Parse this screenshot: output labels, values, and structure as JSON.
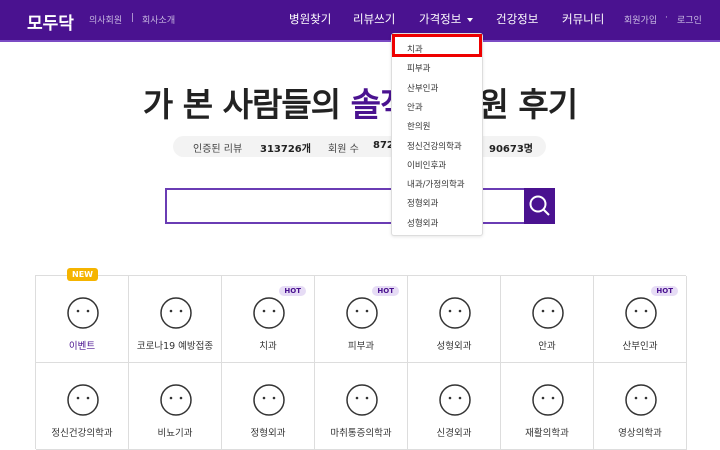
{
  "header": {
    "logo": "모두닥",
    "links": [
      "의사회원",
      "|",
      "회사소개"
    ],
    "nav": [
      "병원찾기",
      "리뷰쓰기",
      "가격정보",
      "건강정보",
      "커뮤니티"
    ],
    "auth": [
      "회원가입",
      "·",
      "로그인"
    ],
    "color": "#4a1290"
  },
  "dropdown": {
    "items": [
      "치과",
      "피부과",
      "산부인과",
      "안과",
      "한의원",
      "정신건강의학과",
      "이비인후과",
      "내과/가정의학과",
      "정형외과",
      "성형외과"
    ],
    "highlighted": "치과"
  },
  "hero": {
    "title_a": "가 본 사람들의 ",
    "title_b": "솔직",
    "title_c": "한 병원 후기"
  },
  "stats": {
    "reviews_label": "인증된 리뷰",
    "reviews": "313726개",
    "members_label": "회원 수",
    "members": "872",
    "third": "90673명"
  },
  "search": {
    "placeholder": "",
    "icon": "search-icon"
  },
  "categories": [
    {
      "label": "이벤트",
      "badge": "NEW"
    },
    {
      "label": "코로나19 예방접종"
    },
    {
      "label": "치과",
      "badge": "HOT"
    },
    {
      "label": "피부과",
      "badge": "HOT"
    },
    {
      "label": "성형외과"
    },
    {
      "label": "안과"
    },
    {
      "label": "산부인과",
      "badge": "HOT"
    },
    {
      "label": "정신건강의학과"
    },
    {
      "label": "비뇨기과"
    },
    {
      "label": "정형외과"
    },
    {
      "label": "마취통증의학과"
    },
    {
      "label": "신경외과"
    },
    {
      "label": "재활의학과"
    },
    {
      "label": "영상의학과"
    }
  ]
}
